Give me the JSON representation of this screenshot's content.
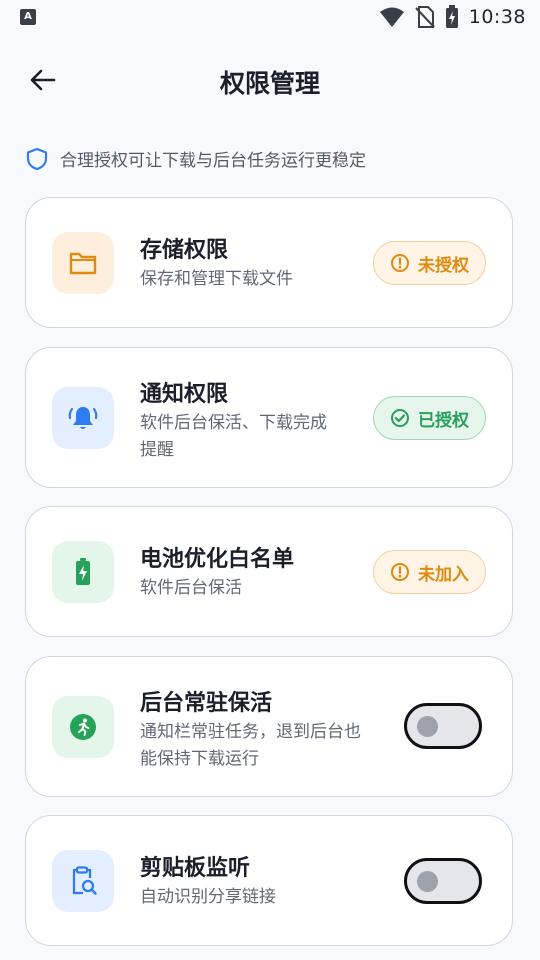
{
  "status_bar": {
    "time": "10:38",
    "app_indicator": "A"
  },
  "header": {
    "title": "权限管理"
  },
  "tip": {
    "text": "合理授权可让下载与后台任务运行更稳定"
  },
  "colors": {
    "orange": "#e08a10",
    "green": "#27a05a",
    "blue": "#2f7bf0"
  },
  "cards": [
    {
      "icon": "folder-icon",
      "title": "存储权限",
      "desc": "保存和管理下载文件",
      "status": "未授权",
      "status_type": "warning"
    },
    {
      "icon": "bell-ringing-icon",
      "title": "通知权限",
      "desc": "软件后台保活、下载完成提醒",
      "status": "已授权",
      "status_type": "granted"
    },
    {
      "icon": "battery-charging-icon",
      "title": "电池优化白名单",
      "desc": "软件后台保活",
      "status": "未加入",
      "status_type": "warning"
    },
    {
      "icon": "running-person-icon",
      "title": "后台常驻保活",
      "desc": "通知栏常驻任务，退到后台也能保持下载运行",
      "toggle": false
    },
    {
      "icon": "clipboard-search-icon",
      "title": "剪贴板监听",
      "desc": "自动识别分享链接",
      "toggle": false
    }
  ]
}
